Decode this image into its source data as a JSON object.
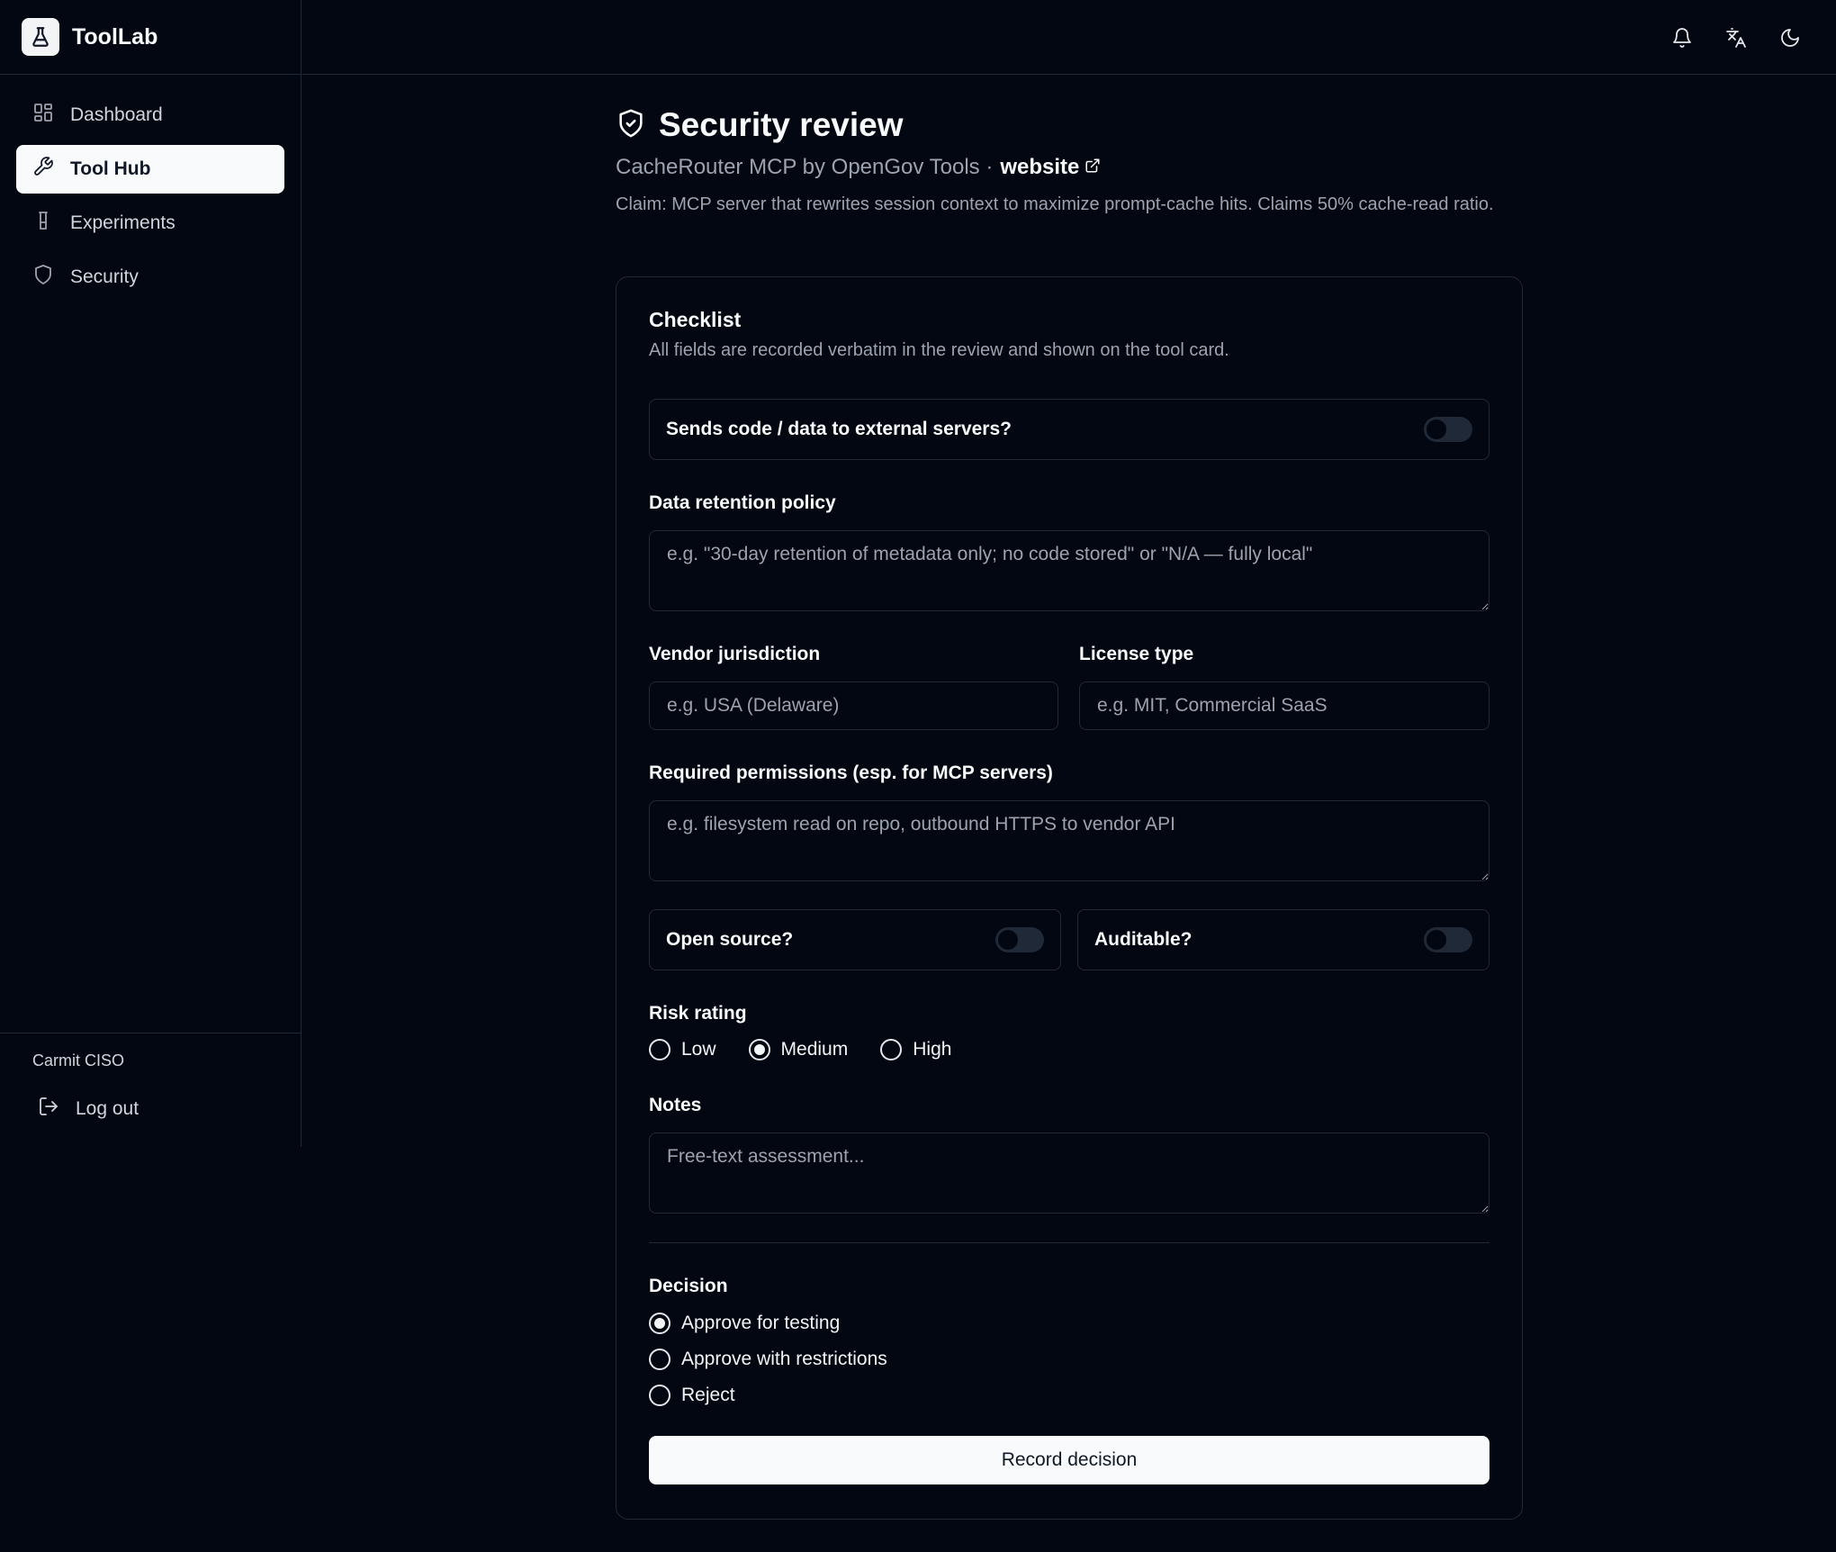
{
  "app": {
    "name": "ToolLab"
  },
  "sidebar": {
    "items": [
      {
        "label": "Dashboard",
        "icon": "dashboard-icon",
        "active": false
      },
      {
        "label": "Tool Hub",
        "icon": "wrench-icon",
        "active": true
      },
      {
        "label": "Experiments",
        "icon": "flask-icon",
        "active": false
      },
      {
        "label": "Security",
        "icon": "shield-icon",
        "active": false
      }
    ],
    "user_name": "Carmit CISO",
    "logout_label": "Log out"
  },
  "topbar": {
    "icons": [
      "bell-icon",
      "translate-icon",
      "moon-icon"
    ]
  },
  "page": {
    "title": "Security review",
    "subtitle_text": "CacheRouter MCP by OpenGov Tools ·",
    "website_label": "website",
    "claim": "Claim: MCP server that rewrites session context to maximize prompt-cache hits. Claims 50% cache-read ratio."
  },
  "checklist": {
    "title": "Checklist",
    "description": "All fields are recorded verbatim in the review and shown on the tool card.",
    "sends_data_label": "Sends code / data to external servers?",
    "retention_label": "Data retention policy",
    "retention_placeholder": "e.g. \"30-day retention of metadata only; no code stored\" or \"N/A — fully local\"",
    "jurisdiction_label": "Vendor jurisdiction",
    "jurisdiction_placeholder": "e.g. USA (Delaware)",
    "license_label": "License type",
    "license_placeholder": "e.g. MIT, Commercial SaaS",
    "permissions_label": "Required permissions (esp. for MCP servers)",
    "permissions_placeholder": "e.g. filesystem read on repo, outbound HTTPS to vendor API",
    "open_source_label": "Open source?",
    "auditable_label": "Auditable?",
    "risk_label": "Risk rating",
    "risk_options": [
      "Low",
      "Medium",
      "High"
    ],
    "risk_selected": "Medium",
    "notes_label": "Notes",
    "notes_placeholder": "Free-text assessment...",
    "decision_label": "Decision",
    "decision_options": [
      "Approve for testing",
      "Approve with restrictions",
      "Reject"
    ],
    "decision_selected": "Approve for testing",
    "record_button": "Record decision"
  },
  "colors": {
    "background": "#030712",
    "border": "#1f2937",
    "muted": "#9ca3af",
    "accent": "#f9fafb"
  }
}
